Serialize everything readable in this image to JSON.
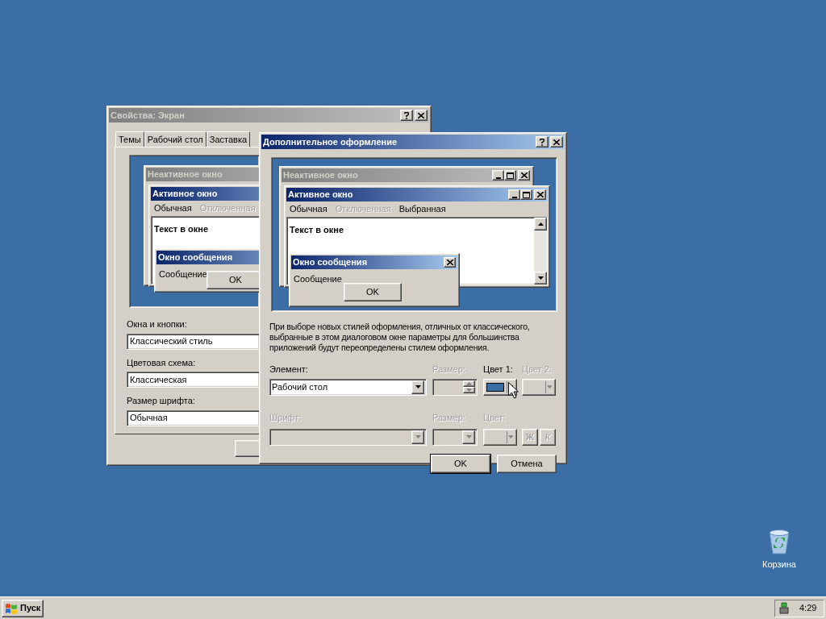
{
  "desktop": {
    "icons": [
      {
        "label": "Корзина"
      }
    ]
  },
  "display_properties": {
    "title": "Свойства: Экран",
    "active": false,
    "tabs": [
      {
        "label": "Темы",
        "selected": false
      },
      {
        "label": "Рабочий стол",
        "selected": false
      },
      {
        "label": "Заставка",
        "selected": false
      }
    ],
    "preview": {
      "inactive_title": "Неактивное окно",
      "active_title": "Активное окно",
      "menu": [
        {
          "label": "Обычная",
          "disabled": false
        },
        {
          "label": "Отключенная",
          "disabled": true
        }
      ],
      "window_text": "Текст в окне",
      "message_title": "Окно сообщения",
      "message_text": "Сообщение",
      "ok": "OK"
    },
    "fields": [
      {
        "label": "Окна и кнопки:",
        "value": "Классический стиль"
      },
      {
        "label": "Цветовая схема:",
        "value": "Классическая"
      },
      {
        "label": "Размер шрифта:",
        "value": "Обычная"
      }
    ]
  },
  "advanced_appearance": {
    "title": "Дополнительное оформление",
    "active": true,
    "preview": {
      "inactive_title": "Неактивное окно",
      "active_title": "Активное окно",
      "menu": [
        {
          "label": "Обычная",
          "disabled": false
        },
        {
          "label": "Отключенная",
          "disabled": true
        },
        {
          "label": "Выбранная",
          "disabled": false
        }
      ],
      "window_text": "Текст в окне",
      "message_title": "Окно сообщения",
      "message_text": "Сообщение",
      "ok": "OK"
    },
    "note": "При выборе новых стилей оформления, отличных от классического, выбранные в этом диалоговом окне параметры для большинства приложений будут переопределены стилем оформления.",
    "element": {
      "label": "Элемент:",
      "value": "Рабочий стол",
      "disabled": false
    },
    "size": {
      "label": "Размер:",
      "disabled": true
    },
    "color1": {
      "label": "Цвет 1:",
      "color": "#3a6ea5",
      "disabled": false
    },
    "color2": {
      "label": "Цвет 2:",
      "disabled": true
    },
    "font": {
      "label": "Шрифт:",
      "disabled": true
    },
    "font_size": {
      "label": "Размер:",
      "disabled": true
    },
    "font_color": {
      "label": "Цвет:",
      "disabled": true
    },
    "bold": {
      "label": "Ж",
      "disabled": true
    },
    "italic": {
      "label": "К",
      "disabled": true
    },
    "buttons": [
      "OK",
      "Отмена"
    ]
  },
  "taskbar": {
    "start": "Пуск",
    "clock": "4:29"
  }
}
